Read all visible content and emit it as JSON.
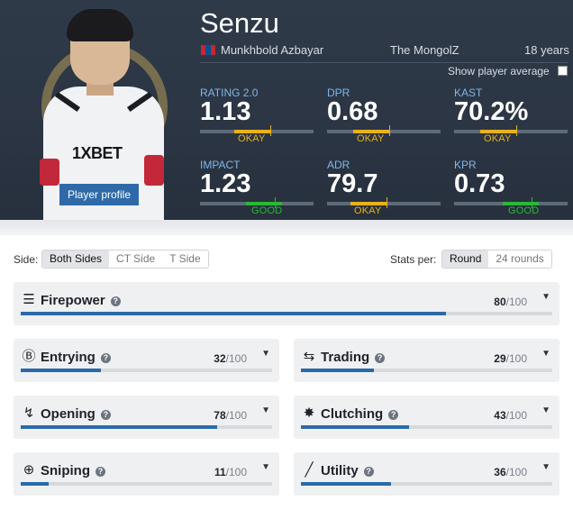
{
  "player": {
    "nickname": "Senzu",
    "real_name": "Munkhbold Azbayar",
    "team": "The MongolZ",
    "age": "18 years",
    "jersey_sponsor": "1XBET",
    "profile_button": "Player profile",
    "flag_colors": [
      "#c4272f",
      "#015197",
      "#c4272f"
    ]
  },
  "show_average_label": "Show player average",
  "stats": [
    {
      "label": "RATING 2.0",
      "value": "1.13",
      "rating": "OKAY",
      "level": 0.62
    },
    {
      "label": "DPR",
      "value": "0.68",
      "rating": "OKAY",
      "level": 0.55
    },
    {
      "label": "KAST",
      "value": "70.2%",
      "rating": "OKAY",
      "level": 0.55
    },
    {
      "label": "IMPACT",
      "value": "1.23",
      "rating": "GOOD",
      "level": 0.66
    },
    {
      "label": "ADR",
      "value": "79.7",
      "rating": "OKAY",
      "level": 0.52
    },
    {
      "label": "KPR",
      "value": "0.73",
      "rating": "GOOD",
      "level": 0.68
    }
  ],
  "filters": {
    "side_label": "Side:",
    "side_options": [
      "Both Sides",
      "CT Side",
      "T Side"
    ],
    "side_selected": "Both Sides",
    "per_label": "Stats per:",
    "per_options": [
      "Round",
      "24 rounds"
    ],
    "per_selected": "Round"
  },
  "categories": [
    {
      "name": "Firepower",
      "icon": "firepower-icon",
      "score": "80",
      "max": "/100",
      "fraction": 0.8
    },
    {
      "name": "Entrying",
      "icon": "entrying-icon",
      "score": "32",
      "max": "/100",
      "fraction": 0.32
    },
    {
      "name": "Trading",
      "icon": "trading-icon",
      "score": "29",
      "max": "/100",
      "fraction": 0.29
    },
    {
      "name": "Opening",
      "icon": "opening-icon",
      "score": "78",
      "max": "/100",
      "fraction": 0.78
    },
    {
      "name": "Clutching",
      "icon": "clutching-icon",
      "score": "43",
      "max": "/100",
      "fraction": 0.43
    },
    {
      "name": "Sniping",
      "icon": "sniping-icon",
      "score": "11",
      "max": "/100",
      "fraction": 0.11
    },
    {
      "name": "Utility",
      "icon": "utility-icon",
      "score": "36",
      "max": "/100",
      "fraction": 0.36
    }
  ],
  "colors": {
    "okay": "#e8b21c",
    "good": "#29b934",
    "progress": "#2a6aa8",
    "header_bg": "#2d3746"
  }
}
